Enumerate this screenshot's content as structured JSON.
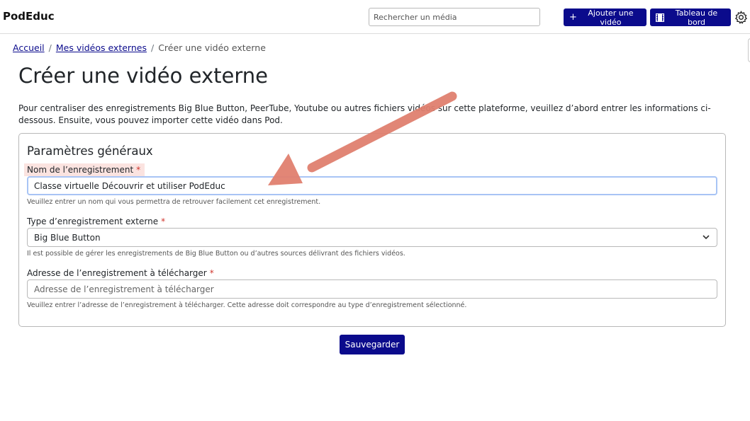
{
  "header": {
    "brand": "PodEduc",
    "search_placeholder": "Rechercher un média",
    "add_video_label": "Ajouter une vidéo",
    "dashboard_label": "Tableau de bord"
  },
  "breadcrumb": {
    "home": "Accueil",
    "external_videos": "Mes vidéos externes",
    "current": "Créer une vidéo externe"
  },
  "page": {
    "title": "Créer une vidéo externe",
    "intro": "Pour centraliser des enregistrements Big Blue Button, PeerTube, Youtube ou autres fichiers vidéos sur cette plateforme, veuillez d’abord entrer les informations ci-dessous. Ensuite, vous pouvez importer cette vidéo dans Pod."
  },
  "form": {
    "section_title": "Paramètres généraux",
    "required_mark": "*",
    "name": {
      "label": "Nom de l’enregistrement",
      "value": "Classe virtuelle Découvrir et utiliser PodEduc",
      "help": "Veuillez entrer un nom qui vous permettra de retrouver facilement cet enregistrement."
    },
    "type": {
      "label": "Type d’enregistrement externe",
      "selected": "Big Blue Button",
      "help": "Il est possible de gérer les enregistrements de Big Blue Button ou d’autres sources délivrant des fichiers vidéos."
    },
    "url": {
      "label": "Adresse de l’enregistrement à télécharger",
      "placeholder": "Adresse de l’enregistrement à télécharger",
      "help": "Veuillez entrer l’adresse de l’enregistrement à télécharger. Cette adresse doit correspondre au type d’enregistrement sélectionné."
    },
    "save_label": "Sauvegarder"
  },
  "colors": {
    "primary": "#0b0b8c",
    "required": "#d0352d",
    "annotation_arrow": "#e0806f",
    "label_highlight": "#fbe3e0"
  },
  "icons": {
    "add": "plus-icon",
    "dashboard": "film-icon",
    "settings": "gear-icon",
    "select": "chevron-down-icon"
  }
}
